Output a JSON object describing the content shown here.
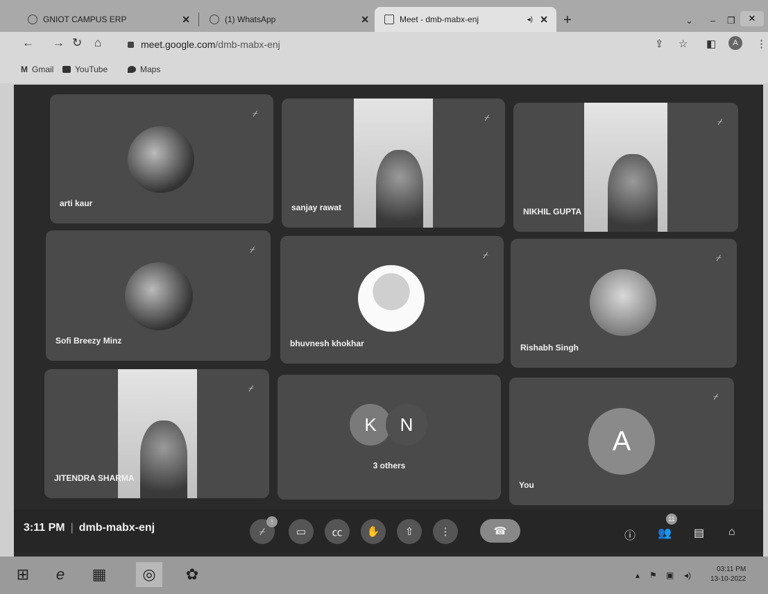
{
  "browser": {
    "tabs": [
      {
        "title": "GNIOT CAMPUS ERP",
        "icon": "globe-icon"
      },
      {
        "title": "(1) WhatsApp",
        "icon": "whatsapp-icon"
      },
      {
        "title": "Meet - dmb-mabx-enj",
        "icon": "meet-icon"
      }
    ],
    "url_host": "meet.google.com",
    "url_path": "/dmb-mabx-enj",
    "profile_initial": "A",
    "bookmarks": [
      "Gmail",
      "YouTube",
      "Maps"
    ]
  },
  "meet": {
    "participants": [
      {
        "name": "arti kaur"
      },
      {
        "name": "sanjay rawat"
      },
      {
        "name": "NIKHIL GUPTA"
      },
      {
        "name": "Sofi Breezy Minz"
      },
      {
        "name": "bhuvnesh khokhar"
      },
      {
        "name": "Rishabh Singh"
      },
      {
        "name": "JITENDRA SHARMA"
      },
      {
        "name": "3 others",
        "initials": [
          "K",
          "N"
        ]
      },
      {
        "name": "You",
        "initial": "A"
      }
    ],
    "time": "3:11 PM",
    "meeting_code": "dmb-mabx-enj",
    "people_count": "11",
    "mic_badge": "!"
  },
  "taskbar": {
    "time": "03:11 PM",
    "date": "13-10-2022"
  },
  "colors": {
    "stage_bg": "#2a2a2a",
    "tile_bg": "#4a4a4a",
    "avatar_you": "#8a8a8a",
    "avatar_k": "#7a7a7a",
    "avatar_n": "#5a5a5a"
  }
}
